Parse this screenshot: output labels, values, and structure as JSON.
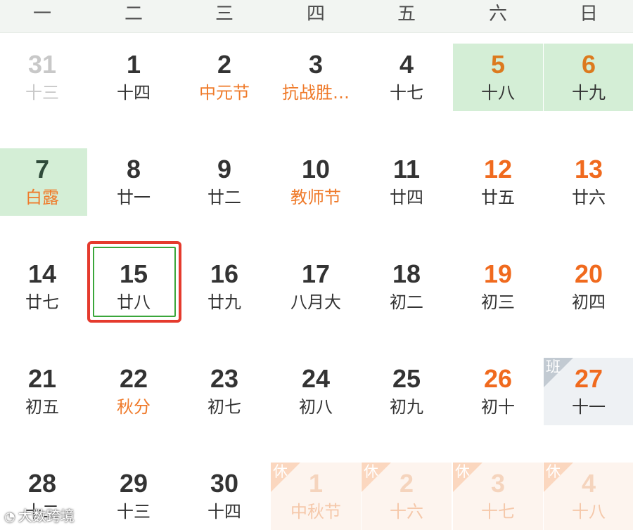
{
  "weekdays": [
    "一",
    "二",
    "三",
    "四",
    "五",
    "六",
    "日"
  ],
  "days": [
    {
      "day": "31",
      "lunar": "十三",
      "day_color": "#c8c8c8",
      "lunar_color": "#c8c8c8"
    },
    {
      "day": "1",
      "lunar": "十四",
      "day_color": "#333333",
      "lunar_color": "#333333"
    },
    {
      "day": "2",
      "lunar": "中元节",
      "day_color": "#333333",
      "lunar_color": "#ef7a2a"
    },
    {
      "day": "3",
      "lunar": "抗战胜…",
      "day_color": "#333333",
      "lunar_color": "#ef7a2a"
    },
    {
      "day": "4",
      "lunar": "十七",
      "day_color": "#333333",
      "lunar_color": "#333333"
    },
    {
      "day": "5",
      "lunar": "十八",
      "day_color": "#dc7a1e",
      "lunar_color": "#333333",
      "bg": "#d4eed6"
    },
    {
      "day": "6",
      "lunar": "十九",
      "day_color": "#dc7a1e",
      "lunar_color": "#333333",
      "bg": "#d4eed6"
    },
    {
      "day": "7",
      "lunar": "白露",
      "day_color": "#2f4a3a",
      "lunar_color": "#ef7a2a",
      "bg": "#d4eed6"
    },
    {
      "day": "8",
      "lunar": "廿一",
      "day_color": "#333333",
      "lunar_color": "#333333"
    },
    {
      "day": "9",
      "lunar": "廿二",
      "day_color": "#333333",
      "lunar_color": "#333333"
    },
    {
      "day": "10",
      "lunar": "教师节",
      "day_color": "#333333",
      "lunar_color": "#ef7a2a"
    },
    {
      "day": "11",
      "lunar": "廿四",
      "day_color": "#333333",
      "lunar_color": "#333333"
    },
    {
      "day": "12",
      "lunar": "廿五",
      "day_color": "#f06a1e",
      "lunar_color": "#333333"
    },
    {
      "day": "13",
      "lunar": "廿六",
      "day_color": "#f06a1e",
      "lunar_color": "#333333"
    },
    {
      "day": "14",
      "lunar": "廿七",
      "day_color": "#333333",
      "lunar_color": "#333333"
    },
    {
      "day": "15",
      "lunar": "廿八",
      "day_color": "#333333",
      "lunar_color": "#333333",
      "selected": true
    },
    {
      "day": "16",
      "lunar": "廿九",
      "day_color": "#333333",
      "lunar_color": "#333333"
    },
    {
      "day": "17",
      "lunar": "八月大",
      "day_color": "#333333",
      "lunar_color": "#333333"
    },
    {
      "day": "18",
      "lunar": "初二",
      "day_color": "#333333",
      "lunar_color": "#333333"
    },
    {
      "day": "19",
      "lunar": "初三",
      "day_color": "#f06a1e",
      "lunar_color": "#333333"
    },
    {
      "day": "20",
      "lunar": "初四",
      "day_color": "#f06a1e",
      "lunar_color": "#333333"
    },
    {
      "day": "21",
      "lunar": "初五",
      "day_color": "#333333",
      "lunar_color": "#333333"
    },
    {
      "day": "22",
      "lunar": "秋分",
      "day_color": "#333333",
      "lunar_color": "#ef7a2a"
    },
    {
      "day": "23",
      "lunar": "初七",
      "day_color": "#333333",
      "lunar_color": "#333333"
    },
    {
      "day": "24",
      "lunar": "初八",
      "day_color": "#333333",
      "lunar_color": "#333333"
    },
    {
      "day": "25",
      "lunar": "初九",
      "day_color": "#333333",
      "lunar_color": "#333333"
    },
    {
      "day": "26",
      "lunar": "初十",
      "day_color": "#f06a1e",
      "lunar_color": "#333333"
    },
    {
      "day": "27",
      "lunar": "十一",
      "day_color": "#f06a1e",
      "lunar_color": "#333333",
      "bg": "#eef1f4",
      "badge": "班"
    },
    {
      "day": "28",
      "lunar": "十二",
      "day_color": "#333333",
      "lunar_color": "#333333"
    },
    {
      "day": "29",
      "lunar": "十三",
      "day_color": "#333333",
      "lunar_color": "#333333"
    },
    {
      "day": "30",
      "lunar": "十四",
      "day_color": "#333333",
      "lunar_color": "#333333"
    },
    {
      "day": "1",
      "lunar": "中秋节",
      "day_color": "#f5d4bd",
      "lunar_color": "#f5c8aa",
      "bg": "#fdf4ee",
      "badge": "休"
    },
    {
      "day": "2",
      "lunar": "十六",
      "day_color": "#f5d4bd",
      "lunar_color": "#f5c8aa",
      "bg": "#fdf4ee",
      "badge": "休"
    },
    {
      "day": "3",
      "lunar": "十七",
      "day_color": "#f5d4bd",
      "lunar_color": "#f5c8aa",
      "bg": "#fdf4ee",
      "badge": "休"
    },
    {
      "day": "4",
      "lunar": "十八",
      "day_color": "#f5d4bd",
      "lunar_color": "#f5c8aa",
      "bg": "#fdf4ee",
      "badge": "休"
    }
  ],
  "watermark": {
    "text": "大数跨境",
    "icon": "camera-icon",
    "icon_glyph": "◔"
  }
}
